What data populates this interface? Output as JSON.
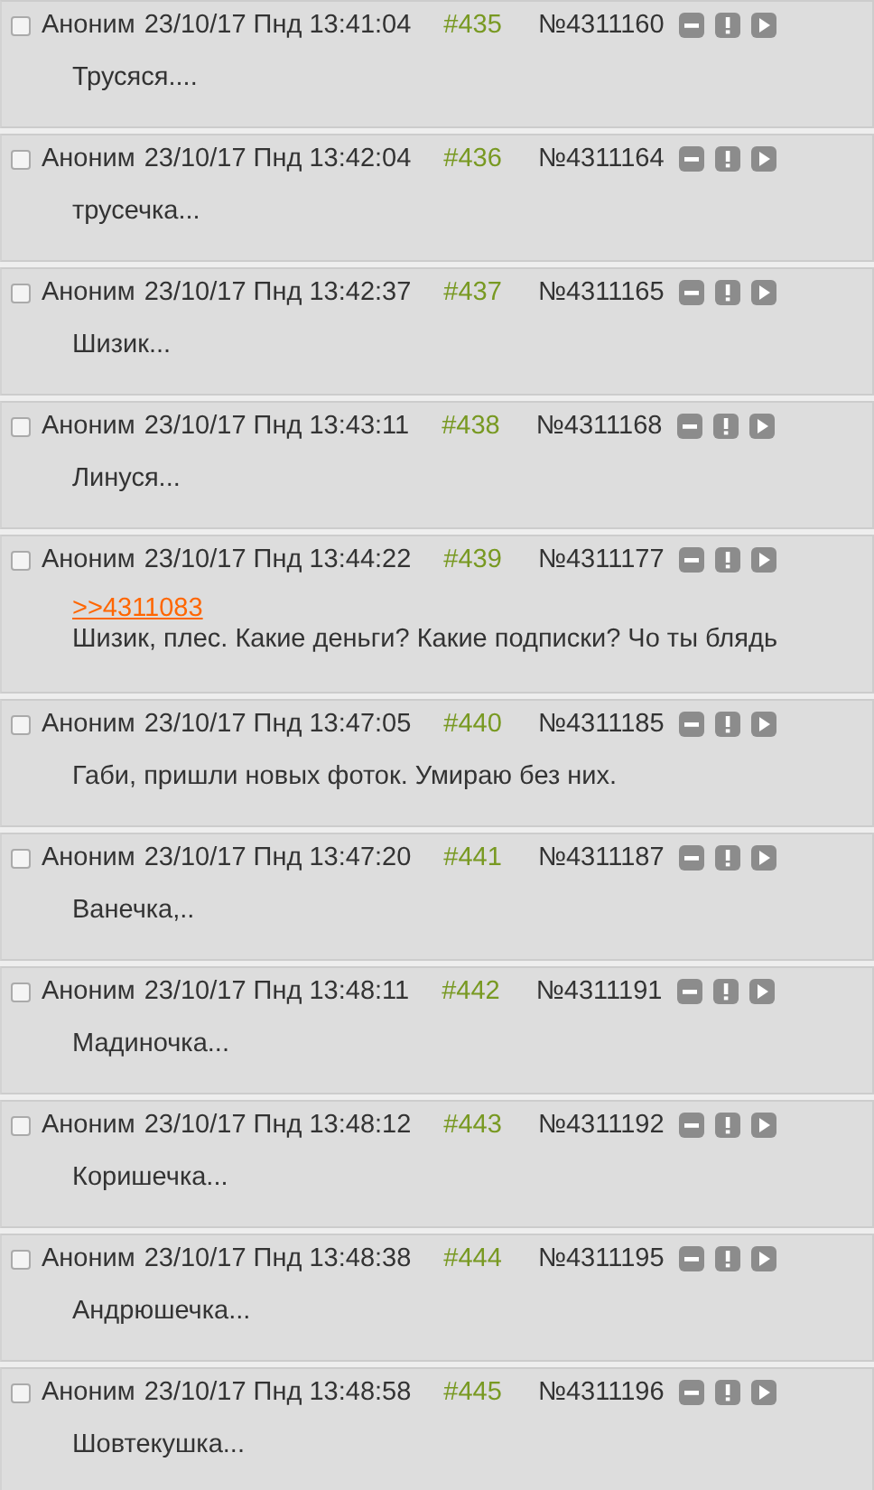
{
  "posts": [
    {
      "selected": false,
      "name": "Аноним",
      "date": "23/10/17 Пнд 13:41:04",
      "num": "#435",
      "id": "№4311160",
      "message": "Трусяся...."
    },
    {
      "selected": false,
      "name": "Аноним",
      "date": "23/10/17 Пнд 13:42:04",
      "num": "#436",
      "id": "№4311164",
      "message": "трусечка..."
    },
    {
      "selected": false,
      "name": "Аноним",
      "date": "23/10/17 Пнд 13:42:37",
      "num": "#437",
      "id": "№4311165",
      "message": "Шизик..."
    },
    {
      "selected": false,
      "name": "Аноним",
      "date": "23/10/17 Пнд 13:43:11",
      "num": "#438",
      "id": "№4311168",
      "message": "Линуся..."
    },
    {
      "selected": false,
      "name": "Аноним",
      "date": "23/10/17 Пнд 13:44:22",
      "num": "#439",
      "id": "№4311177",
      "reply_link": ">>4311083",
      "message": "Шизик, плес. Какие деньги? Какие подписки? Чо ты блядь"
    },
    {
      "selected": false,
      "name": "Аноним",
      "date": "23/10/17 Пнд 13:47:05",
      "num": "#440",
      "id": "№4311185",
      "message": "Габи, пришли новых фоток. Умираю без них."
    },
    {
      "selected": false,
      "name": "Аноним",
      "date": "23/10/17 Пнд 13:47:20",
      "num": "#441",
      "id": "№4311187",
      "message": "Ванечка,.."
    },
    {
      "selected": false,
      "name": "Аноним",
      "date": "23/10/17 Пнд 13:48:11",
      "num": "#442",
      "id": "№4311191",
      "message": "Мадиночка..."
    },
    {
      "selected": false,
      "name": "Аноним",
      "date": "23/10/17 Пнд 13:48:12",
      "num": "#443",
      "id": "№4311192",
      "message": "Коришечка..."
    },
    {
      "selected": false,
      "name": "Аноним",
      "date": "23/10/17 Пнд 13:48:38",
      "num": "#444",
      "id": "№4311195",
      "message": "Андрюшечка..."
    },
    {
      "selected": false,
      "name": "Аноним",
      "date": "23/10/17 Пнд 13:48:58",
      "num": "#445",
      "id": "№4311196",
      "message": "Шовтекушка..."
    }
  ]
}
